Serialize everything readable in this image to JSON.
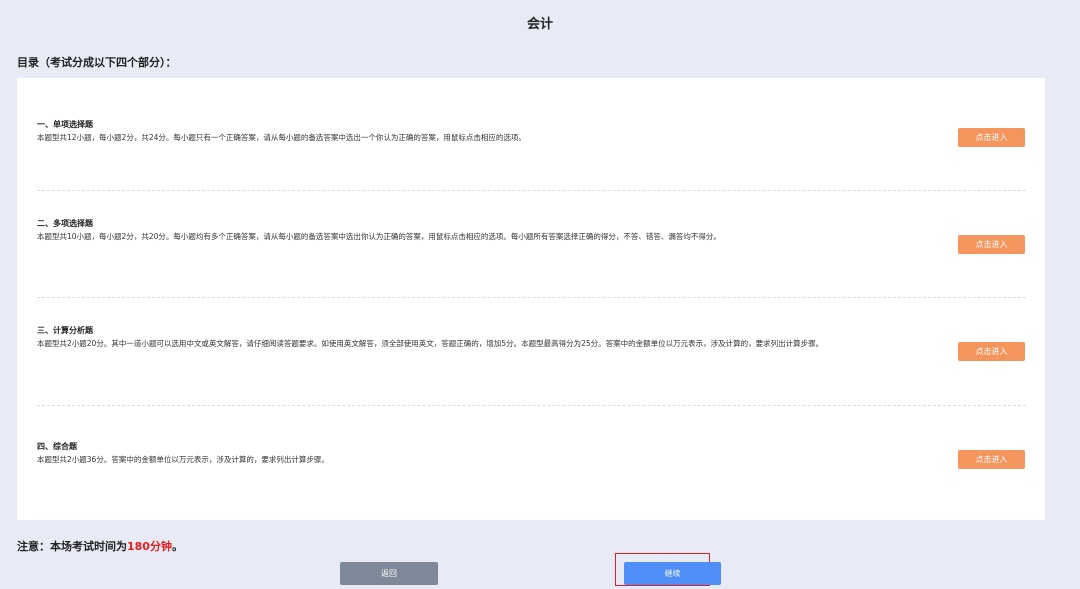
{
  "page": {
    "title": "会计",
    "toc_heading": "目录（考试分成以下四个部分）："
  },
  "sections": [
    {
      "title": "一、单项选择题",
      "description": "本题型共12小题，每小题2分，共24分。每小题只有一个正确答案，请从每小题的备选答案中选出一个你认为正确的答案，用鼠标点击相应的选项。",
      "button_label": "点击进入"
    },
    {
      "title": "二、多项选择题",
      "description": "本题型共10小题，每小题2分，共20分。每小题均有多个正确答案，请从每小题的备选答案中选出你认为正确的答案，用鼠标点击相应的选项。每小题所有答案选择正确的得分，不答、错答、漏答均不得分。",
      "button_label": "点击进入"
    },
    {
      "title": "三、计算分析题",
      "description": "本题型共2小题20分。其中一道小题可以选用中文或英文解答，请仔细阅读答题要求。如使用英文解答，须全部使用英文，答题正确的，增加5分。本题型最高得分为25分。答案中的金额单位以万元表示，涉及计算的，要求列出计算步骤。",
      "button_label": "点击进入"
    },
    {
      "title": "四、综合题",
      "description": "本题型共2小题36分。答案中的金额单位以万元表示，涉及计算的，要求列出计算步骤。",
      "button_label": "点击进入"
    }
  ],
  "notice": {
    "prefix": "注意：本场考试时间为",
    "highlight": "180分钟",
    "suffix": "。"
  },
  "footer": {
    "back_label": "返回",
    "continue_label": "继续"
  },
  "colors": {
    "background": "#e8ebf6",
    "enter_button": "#f5955e",
    "back_button": "#7f8899",
    "continue_button": "#4f8ef7",
    "highlight_text": "#e41e1e",
    "focus_frame": "#e0202a"
  }
}
